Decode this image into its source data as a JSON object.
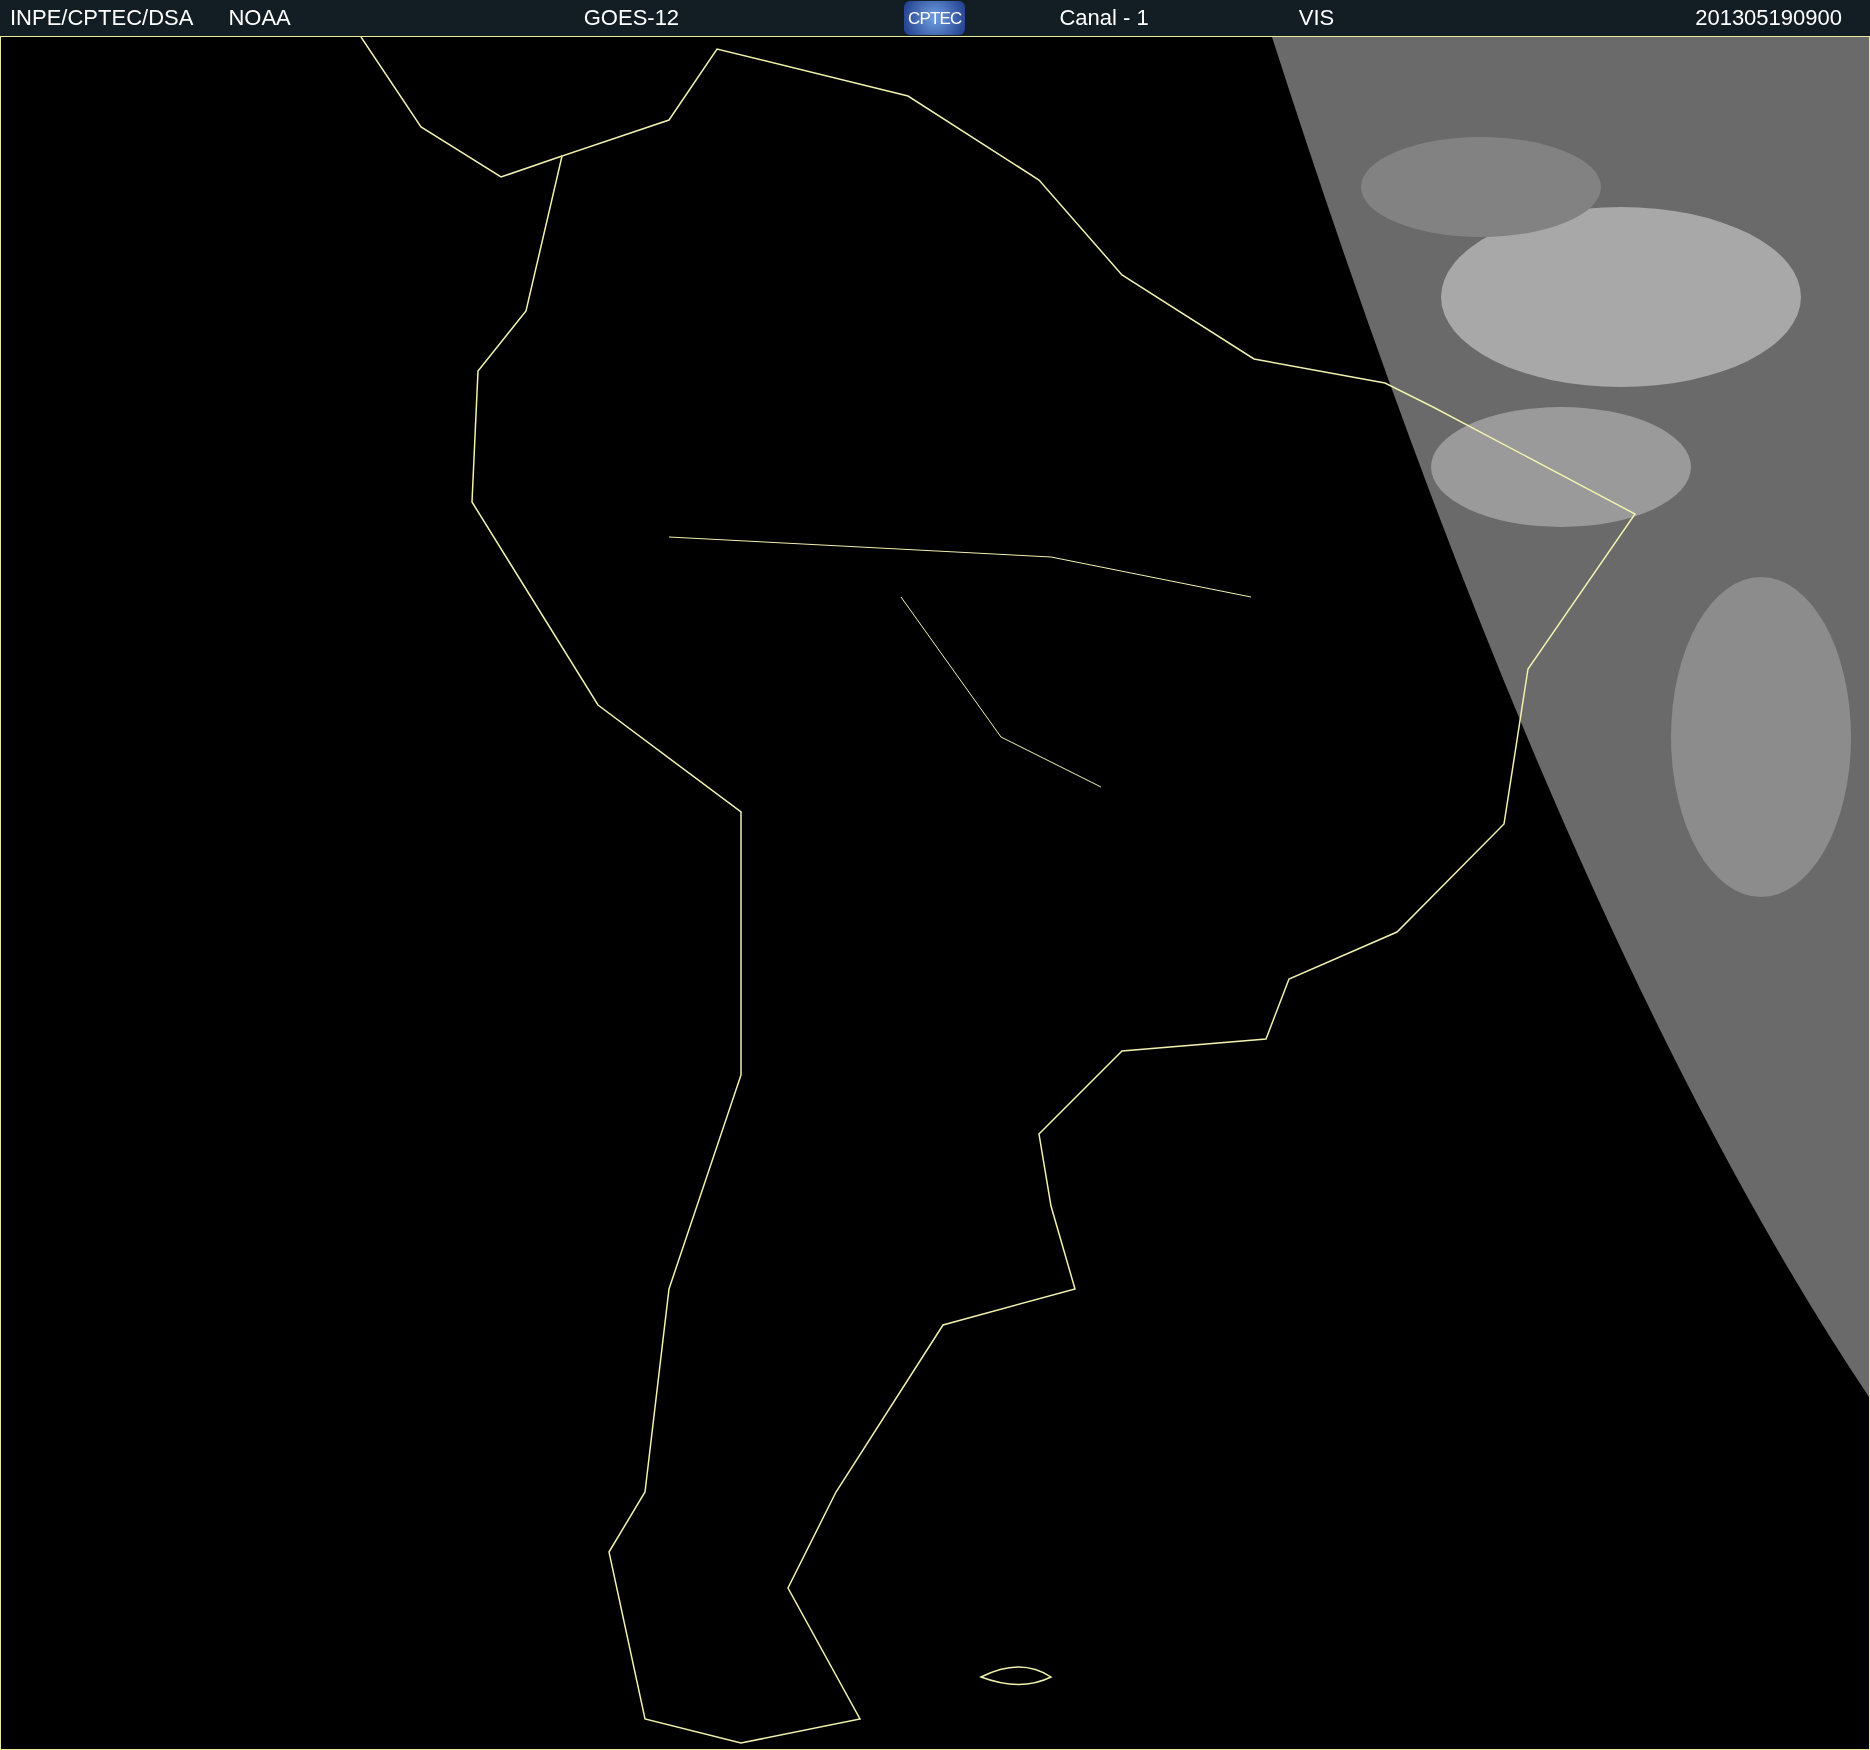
{
  "header": {
    "items": [
      {
        "kind": "text",
        "text": "INPE/CPTEC/DSA"
      },
      {
        "kind": "text",
        "text": "NOAA"
      },
      {
        "kind": "text",
        "text": "GOES-12"
      },
      {
        "kind": "logo",
        "text": "CPTEC"
      },
      {
        "kind": "text",
        "text": "Canal - 1"
      },
      {
        "kind": "text",
        "text": "VIS"
      },
      {
        "kind": "text",
        "text": "201305190900"
      }
    ]
  }
}
